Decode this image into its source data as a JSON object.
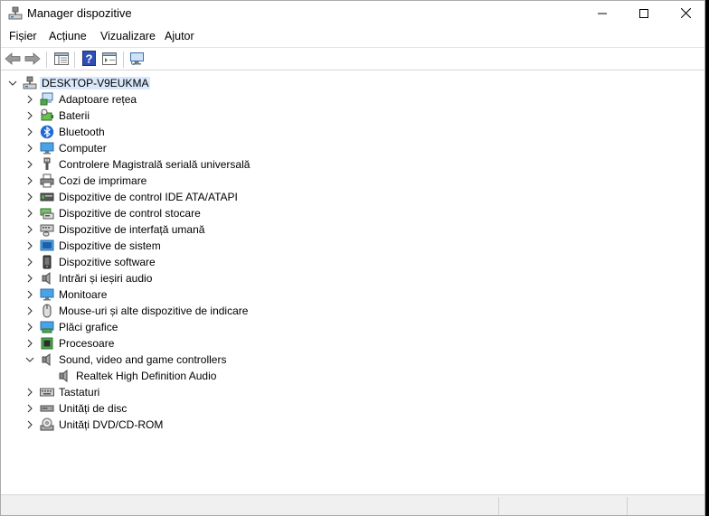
{
  "window": {
    "title": "Manager dispozitive"
  },
  "menu": [
    "Fișier",
    "Acțiune",
    "Vizualizare",
    "Ajutor"
  ],
  "tree": {
    "root": "DESKTOP-V9EUKMA",
    "categories": [
      {
        "label": "Adaptoare rețea",
        "icon": "network-adapter-icon",
        "expanded": false
      },
      {
        "label": "Baterii",
        "icon": "battery-icon",
        "expanded": false
      },
      {
        "label": "Bluetooth",
        "icon": "bluetooth-icon",
        "expanded": false
      },
      {
        "label": "Computer",
        "icon": "computer-icon",
        "expanded": false
      },
      {
        "label": "Controlere Magistrală serială universală",
        "icon": "usb-icon",
        "expanded": false
      },
      {
        "label": "Cozi de imprimare",
        "icon": "printer-icon",
        "expanded": false
      },
      {
        "label": "Dispozitive de control IDE ATA/ATAPI",
        "icon": "ide-controller-icon",
        "expanded": false
      },
      {
        "label": "Dispozitive de control stocare",
        "icon": "storage-controller-icon",
        "expanded": false
      },
      {
        "label": "Dispozitive de interfață umană",
        "icon": "hid-icon",
        "expanded": false
      },
      {
        "label": "Dispozitive de sistem",
        "icon": "system-device-icon",
        "expanded": false
      },
      {
        "label": "Dispozitive software",
        "icon": "software-device-icon",
        "expanded": false
      },
      {
        "label": "Intrări și ieșiri audio",
        "icon": "audio-io-icon",
        "expanded": false
      },
      {
        "label": "Monitoare",
        "icon": "monitor-icon",
        "expanded": false
      },
      {
        "label": "Mouse-uri și alte dispozitive de indicare",
        "icon": "mouse-icon",
        "expanded": false
      },
      {
        "label": "Plăci grafice",
        "icon": "display-adapter-icon",
        "expanded": false
      },
      {
        "label": "Procesoare",
        "icon": "processor-icon",
        "expanded": false
      },
      {
        "label": "Sound, video and game controllers",
        "icon": "speaker-icon",
        "expanded": true
      },
      {
        "label": "Realtek High Definition Audio",
        "icon": "speaker-icon",
        "child": true
      },
      {
        "label": "Tastaturi",
        "icon": "keyboard-icon",
        "expanded": false
      },
      {
        "label": "Unități de disc",
        "icon": "disk-drive-icon",
        "expanded": false
      },
      {
        "label": "Unități DVD/CD-ROM",
        "icon": "dvd-drive-icon",
        "expanded": false
      }
    ]
  },
  "colors": {
    "selection": "#d9e8fb",
    "accent": "#2b6fc4"
  }
}
